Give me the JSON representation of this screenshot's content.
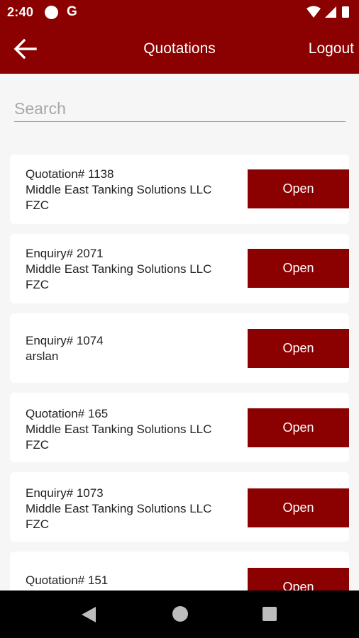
{
  "status_bar": {
    "time": "2:40",
    "g_label": "G"
  },
  "app_bar": {
    "title": "Quotations",
    "logout_label": "Logout"
  },
  "search": {
    "placeholder": "Search",
    "value": ""
  },
  "items": [
    {
      "line1": "Quotation# 1138",
      "line2": "Middle East Tanking Solutions LLC",
      "line3": "FZC",
      "button": "Open"
    },
    {
      "line1": "Enquiry# 2071",
      "line2": "Middle East Tanking Solutions LLC",
      "line3": "FZC",
      "button": "Open"
    },
    {
      "line1": "Enquiry# 1074",
      "line2": "arslan",
      "line3": "",
      "button": "Open"
    },
    {
      "line1": "Quotation# 165",
      "line2": "Middle East Tanking Solutions LLC",
      "line3": "FZC",
      "button": "Open"
    },
    {
      "line1": "Enquiry# 1073",
      "line2": "Middle East Tanking Solutions LLC",
      "line3": "FZC",
      "button": "Open"
    },
    {
      "line1": "Quotation# 151",
      "line2": "",
      "line3": "",
      "button": "Open"
    }
  ],
  "colors": {
    "primary": "#8b0000",
    "background": "#f6f6f6",
    "card": "#ffffff"
  }
}
